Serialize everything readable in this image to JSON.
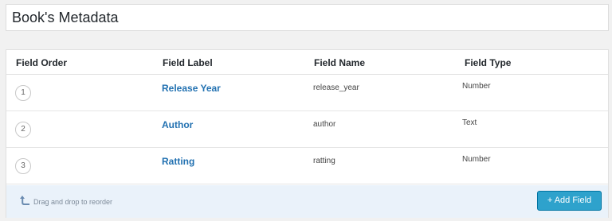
{
  "page_title": "Book's Metadata",
  "table": {
    "headers": {
      "order": "Field Order",
      "label": "Field Label",
      "name": "Field Name",
      "type": "Field Type"
    },
    "rows": [
      {
        "order": "1",
        "label": "Release Year",
        "name": "release_year",
        "type": "Number"
      },
      {
        "order": "2",
        "label": "Author",
        "name": "author",
        "type": "Text"
      },
      {
        "order": "3",
        "label": "Ratting",
        "name": "ratting",
        "type": "Number"
      }
    ]
  },
  "footer": {
    "hint_text": "Drag and drop to reorder",
    "hint_icon": "arrow-up-icon",
    "add_button_label": "+ Add Field"
  },
  "colors": {
    "accent": "#2ea2cc",
    "link": "#2271b1",
    "footer_bg": "#eaf2fa"
  }
}
